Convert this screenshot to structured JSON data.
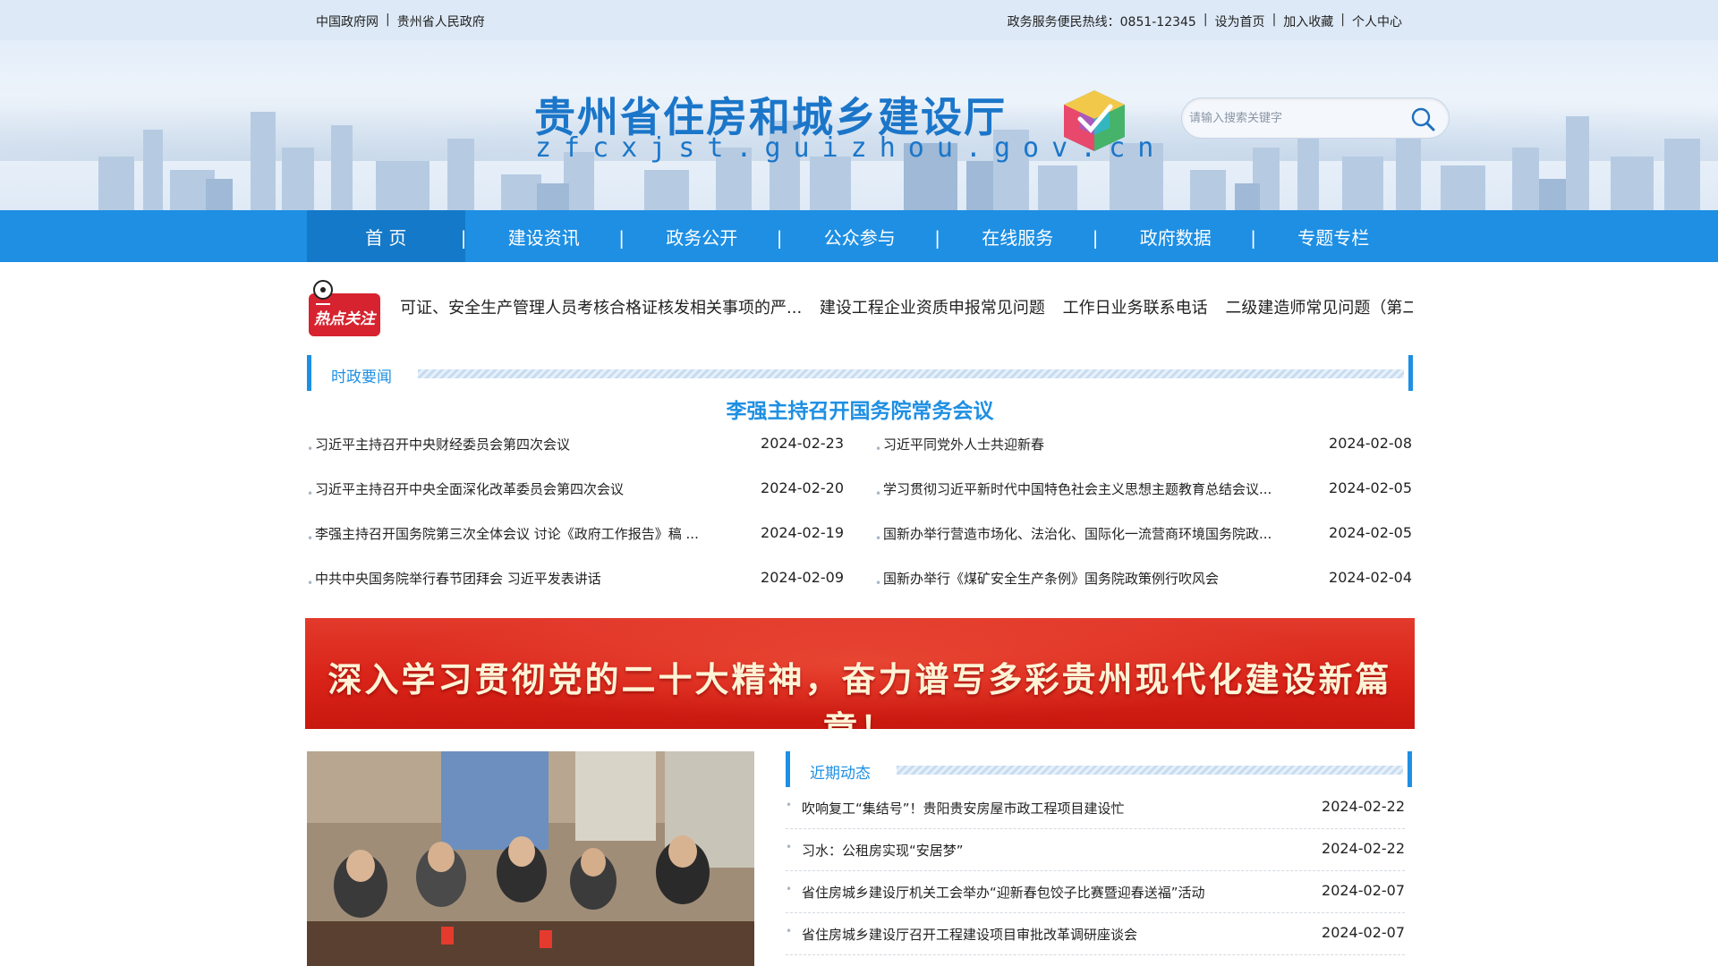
{
  "topbar": {
    "left_links": [
      "中国政府网",
      "贵州省人民政府"
    ],
    "right_links": [
      "政务服务便民热线：0851-12345",
      "设为首页",
      "加入收藏",
      "个人中心"
    ],
    "separator": "|"
  },
  "header": {
    "title": "贵州省住房和城乡建设厅",
    "domain": "zfcxjst.guizhou.gov.cn",
    "logo_icon": "colorful-cube-logo-icon",
    "search": {
      "placeholder": "请输入搜索关键字",
      "icon": "search-icon"
    }
  },
  "nav": {
    "items": [
      {
        "label": "首 页",
        "active": true
      },
      {
        "label": "建设资讯",
        "active": false
      },
      {
        "label": "政务公开",
        "active": false
      },
      {
        "label": "公众参与",
        "active": false
      },
      {
        "label": "在线服务",
        "active": false
      },
      {
        "label": "政府数据",
        "active": false
      },
      {
        "label": "专题专栏",
        "active": false
      }
    ],
    "divider": "|"
  },
  "hot": {
    "badge_label": "热点关注",
    "items": [
      "可证、安全生产管理人员考核合格证核发相关事项的严...",
      "建设工程企业资质申报常见问题",
      "工作日业务联系电话",
      "二级建造师常见问题（第二版"
    ]
  },
  "politics": {
    "section_label": "时政要闻",
    "headline": "李强主持召开国务院常务会议",
    "left": [
      {
        "title": "习近平主持召开中央财经委员会第四次会议",
        "date": "2024-02-23"
      },
      {
        "title": "习近平主持召开中央全面深化改革委员会第四次会议",
        "date": "2024-02-20"
      },
      {
        "title": "李强主持召开国务院第三次全体会议 讨论《政府工作报告》稿 ...",
        "date": "2024-02-19"
      },
      {
        "title": "中共中央国务院举行春节团拜会 习近平发表讲话",
        "date": "2024-02-09"
      }
    ],
    "right": [
      {
        "title": "习近平同党外人士共迎新春",
        "date": "2024-02-08"
      },
      {
        "title": "学习贯彻习近平新时代中国特色社会主义思想主题教育总结会议...",
        "date": "2024-02-05"
      },
      {
        "title": "国新办举行营造市场化、法治化、国际化一流营商环境国务院政...",
        "date": "2024-02-05"
      },
      {
        "title": "国新办举行《煤矿安全生产条例》国务院政策例行吹风会",
        "date": "2024-02-04"
      }
    ]
  },
  "banner": {
    "slogan": "深入学习贯彻党的二十大精神，奋力谱写多彩贵州现代化建设新篇章！"
  },
  "recent": {
    "section_label": "近期动态",
    "items": [
      {
        "title": "吹响复工“集结号”！贵阳贵安房屋市政工程项目建设忙",
        "date": "2024-02-22"
      },
      {
        "title": "习水：公租房实现“安居梦”",
        "date": "2024-02-22"
      },
      {
        "title": "省住房城乡建设厅机关工会举办“迎新春包饺子比赛暨迎春送福”活动",
        "date": "2024-02-07"
      },
      {
        "title": "省住房城乡建设厅召开工程建设项目审批改革调研座谈会",
        "date": "2024-02-07"
      }
    ]
  },
  "colors": {
    "primary_blue": "#1e8fe3",
    "nav_active": "#1479c8",
    "banner_red": "#d92318"
  }
}
